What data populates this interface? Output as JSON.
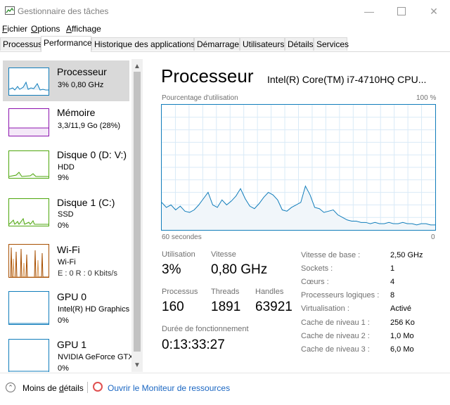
{
  "window": {
    "title": "Gestionnaire des tâches"
  },
  "menu": [
    {
      "label": "Fichier",
      "accel": "F",
      "rest": "ichier"
    },
    {
      "label": "Options",
      "accel": "O",
      "rest": "ptions"
    },
    {
      "label": "Affichage",
      "accel": "A",
      "rest": "ffichage"
    }
  ],
  "tabs": [
    "Processus",
    "Performance",
    "Historique des applications",
    "Démarrage",
    "Utilisateurs",
    "Détails",
    "Services"
  ],
  "sidebar": {
    "items": [
      {
        "title": "Processeur",
        "sub1": "3%  0,80 GHz",
        "sub2": "",
        "sub3": "",
        "color": "#117dbb"
      },
      {
        "title": "Mémoire",
        "sub1": "3,3/11,9 Go (28%)",
        "sub2": "",
        "sub3": "",
        "color": "#8b12ae"
      },
      {
        "title": "Disque 0 (D: V:)",
        "sub1": "HDD",
        "sub2": "9%",
        "sub3": "",
        "color": "#4da60c"
      },
      {
        "title": "Disque 1 (C:)",
        "sub1": "SSD",
        "sub2": "0%",
        "sub3": "",
        "color": "#4da60c"
      },
      {
        "title": "Wi-Fi",
        "sub1": "Wi-Fi",
        "sub2": "E : 0 R : 0 Kbits/s",
        "sub3": "",
        "color": "#a74f01"
      },
      {
        "title": "GPU 0",
        "sub1": "Intel(R) HD Graphics",
        "sub2": "0%",
        "sub3": "",
        "color": "#117dbb"
      },
      {
        "title": "GPU 1",
        "sub1": "NVIDIA GeForce GTX",
        "sub2": "0%",
        "sub3": "",
        "color": "#117dbb"
      }
    ]
  },
  "main": {
    "title": "Processeur",
    "cpu_model": "Intel(R) Core(TM) i7-4710HQ CPU...",
    "graph_top_left": "Pourcentage d'utilisation",
    "graph_top_right": "100 %",
    "graph_bottom_left": "60 secondes",
    "graph_bottom_right": "0",
    "usage_series": [
      22,
      18,
      20,
      16,
      19,
      15,
      14,
      16,
      20,
      25,
      30,
      20,
      18,
      24,
      20,
      23,
      27,
      33,
      25,
      19,
      17,
      21,
      26,
      30,
      28,
      24,
      16,
      15,
      18,
      20,
      22,
      35,
      28,
      18,
      17,
      14,
      15,
      16,
      12,
      10,
      8,
      7,
      7,
      6,
      6,
      5,
      6,
      5,
      5,
      6,
      5,
      5,
      6,
      5,
      5,
      4,
      5,
      5,
      4,
      4
    ],
    "graph_color": "#117dbb",
    "stats": {
      "usage_label": "Utilisation",
      "usage_value": "3%",
      "speed_label": "Vitesse",
      "speed_value": "0,80 GHz",
      "proc_label": "Processus",
      "proc_value": "160",
      "threads_label": "Threads",
      "threads_value": "1891",
      "handles_label": "Handles",
      "handles_value": "63921",
      "uptime_label": "Durée de fonctionnement",
      "uptime_value": "0:13:33:27"
    },
    "info": [
      {
        "label": "Vitesse de base :",
        "value": "2,50 GHz"
      },
      {
        "label": "Sockets :",
        "value": "1"
      },
      {
        "label": "Cœurs :",
        "value": "4"
      },
      {
        "label": "Processeurs logiques :",
        "value": "8"
      },
      {
        "label": "Virtualisation :",
        "value": "Activé"
      },
      {
        "label": "Cache de niveau 1 :",
        "value": "256 Ko"
      },
      {
        "label": "Cache de niveau 2 :",
        "value": "1,0 Mo"
      },
      {
        "label": "Cache de niveau 3 :",
        "value": "6,0 Mo"
      }
    ]
  },
  "footer": {
    "less_details_pre": "Moins de ",
    "less_details_accel": "d",
    "less_details_post": "étails",
    "resource_monitor": "Ouvrir le Moniteur de ressources"
  }
}
